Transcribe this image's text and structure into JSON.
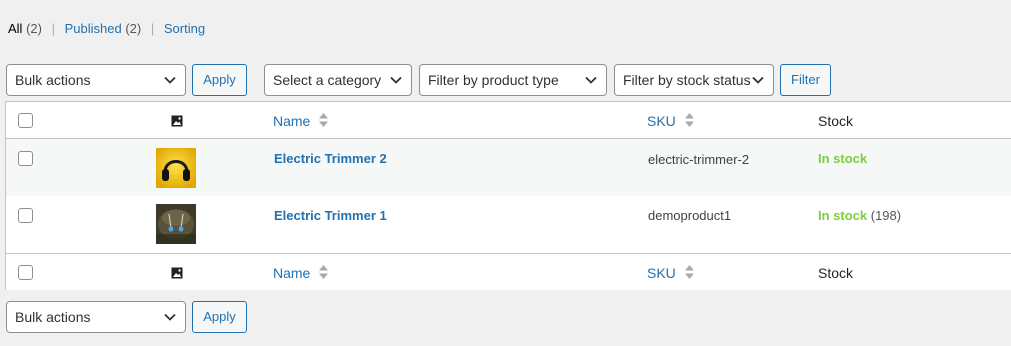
{
  "views": {
    "all": {
      "label": "All",
      "count": "(2)"
    },
    "published": {
      "label": "Published",
      "count": "(2)"
    },
    "sorting": {
      "label": "Sorting"
    },
    "separator": "|"
  },
  "filters": {
    "bulk_actions": "Bulk actions",
    "apply": "Apply",
    "category": "Select a category",
    "product_type": "Filter by product type",
    "stock_status": "Filter by stock status",
    "filter_button": "Filter"
  },
  "table": {
    "columns": {
      "name": "Name",
      "sku": "SKU",
      "stock": "Stock"
    },
    "rows": [
      {
        "name": "Electric Trimmer 2",
        "sku": "electric-trimmer-2",
        "stock_status": "In stock",
        "stock_qty": "",
        "thumb_icon": "headphones-thumbnail"
      },
      {
        "name": "Electric Trimmer 1",
        "sku": "demoproduct1",
        "stock_status": "In stock",
        "stock_qty": "(198)",
        "thumb_icon": "jewelry-thumbnail"
      }
    ]
  },
  "bottom": {
    "bulk_actions": "Bulk actions",
    "apply": "Apply"
  },
  "colors": {
    "link": "#2271b1",
    "in_stock": "#7ad03a",
    "alt_row": "#f6f7f7",
    "background": "#f0f0f1"
  }
}
